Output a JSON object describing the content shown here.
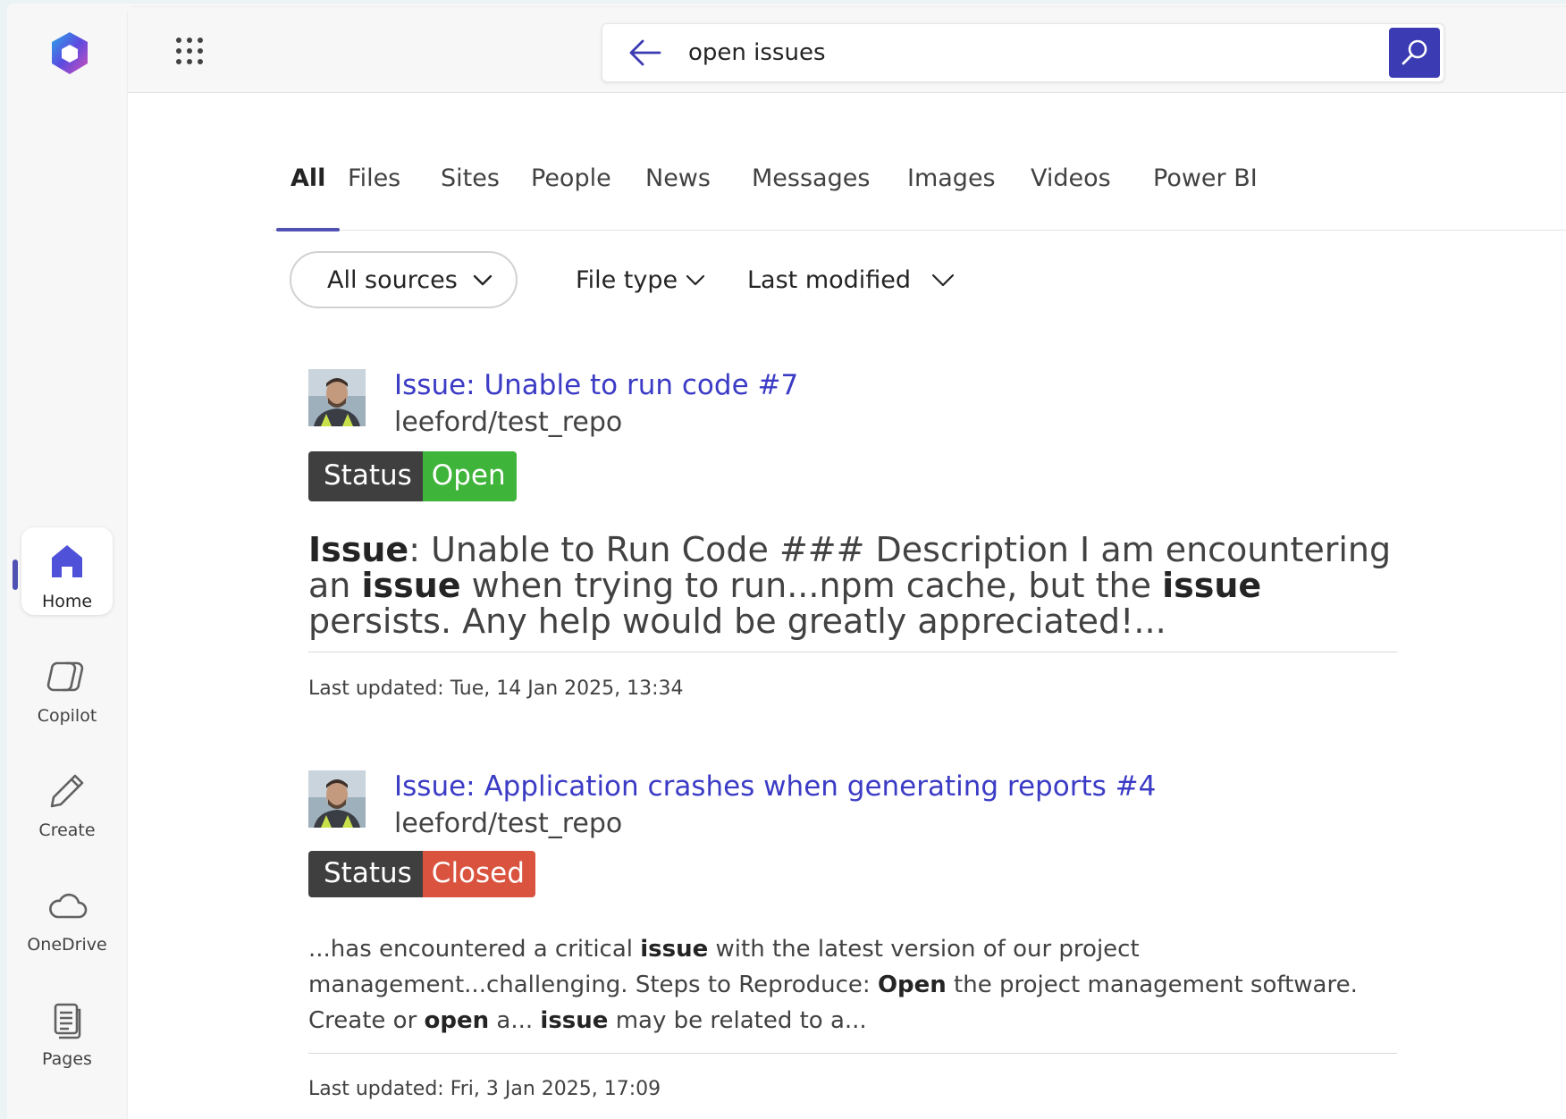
{
  "app": {
    "logo_icon": "m365-logo-icon"
  },
  "rail": {
    "items": [
      {
        "label": "Home",
        "icon": "home-icon",
        "active": true
      },
      {
        "label": "Copilot",
        "icon": "copilot-icon"
      },
      {
        "label": "Create",
        "icon": "pen-icon"
      },
      {
        "label": "OneDrive",
        "icon": "cloud-icon"
      },
      {
        "label": "Pages",
        "icon": "pages-icon"
      }
    ]
  },
  "search": {
    "query": "open issues",
    "button_color": "#3b3bb3"
  },
  "tabs": [
    "All",
    "Files",
    "Sites",
    "People",
    "News",
    "Messages",
    "Images",
    "Videos",
    "Power BI"
  ],
  "filters": {
    "sources": "All sources",
    "file_type": "File type",
    "last_modified": "Last modified"
  },
  "results": [
    {
      "title": "Issue: Unable to run code #7",
      "repo": "leeford/test_repo",
      "status_key": "Status",
      "status_value": "Open",
      "status_color": "#3fb43a",
      "snippet": [
        {
          "t": "Issue",
          "b": true
        },
        {
          "t": ": Unable to Run Code ### Description I am encountering an "
        },
        {
          "t": "issue",
          "b": true
        },
        {
          "t": " when trying to run...npm cache, but the "
        },
        {
          "t": "issue",
          "b": true
        },
        {
          "t": " persists. Any help would be greatly appreciated!..."
        }
      ],
      "updated": "Last updated: Tue, 14 Jan 2025, 13:34"
    },
    {
      "title": "Issue: Application crashes when generating reports #4",
      "repo": "leeford/test_repo",
      "status_key": "Status",
      "status_value": "Closed",
      "status_color": "#d9533f",
      "snippet": [
        {
          "t": "...has encountered a critical "
        },
        {
          "t": "issue",
          "b": true
        },
        {
          "t": " with the latest version of our project management...challenging. Steps to Reproduce: "
        },
        {
          "t": "Open",
          "b": true
        },
        {
          "t": " the project management software. Create or "
        },
        {
          "t": "open",
          "b": true
        },
        {
          "t": " a... "
        },
        {
          "t": "issue",
          "b": true
        },
        {
          "t": " may be related to a..."
        }
      ],
      "updated": "Last updated: Fri, 3 Jan 2025, 17:09"
    }
  ]
}
